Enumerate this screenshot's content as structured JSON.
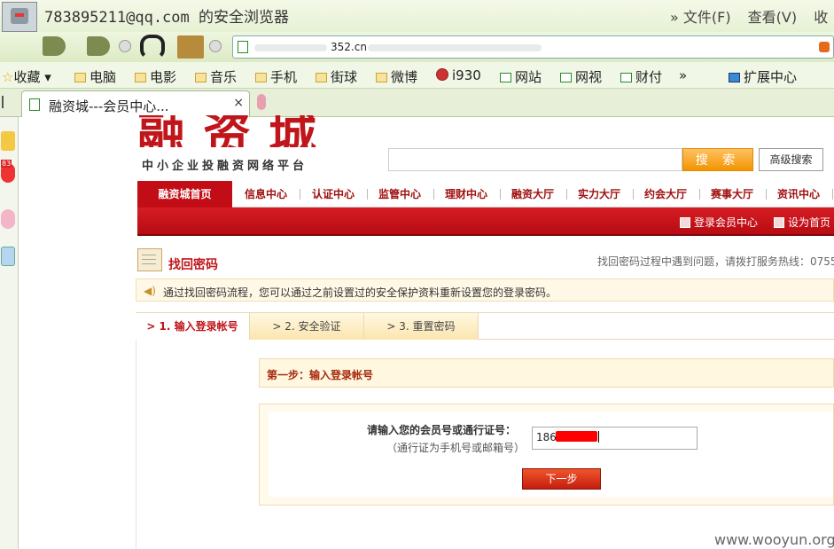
{
  "window": {
    "title": "783895211@qq.com 的安全浏览器",
    "menu": [
      "» 文件(F)",
      "查看(V)",
      "收"
    ]
  },
  "address_bar": {
    "url": "352.cn"
  },
  "favorites": [
    {
      "label": "收藏 ▾",
      "icon": "star-icon"
    },
    {
      "label": "电脑",
      "icon": "folder-icon"
    },
    {
      "label": "电影",
      "icon": "folder-icon"
    },
    {
      "label": "音乐",
      "icon": "folder-icon"
    },
    {
      "label": "手机",
      "icon": "folder-icon"
    },
    {
      "label": "街球",
      "icon": "folder-icon"
    },
    {
      "label": "微博",
      "icon": "folder-icon"
    },
    {
      "label": "i930",
      "icon": "player-icon"
    },
    {
      "label": "网站",
      "icon": "page-icon"
    },
    {
      "label": "网视",
      "icon": "page-icon"
    },
    {
      "label": "财付",
      "icon": "page-icon"
    },
    {
      "label": "»",
      "icon": ""
    },
    {
      "label": "扩展中心",
      "icon": "extension-icon"
    }
  ],
  "tab": {
    "title": "融资城---会员中心...",
    "close": "×"
  },
  "sidebar": {
    "badge": "83"
  },
  "site": {
    "logo_chars": "融资城",
    "slogan": "中小企业投融资网络平台",
    "search_button": "搜 索",
    "advanced_search": "高级搜索"
  },
  "main_nav": [
    "融资城首页",
    "信息中心",
    "认证中心",
    "监管中心",
    "理财中心",
    "融资大厅",
    "实力大厅",
    "约会大厅",
    "赛事大厅",
    "资讯中心"
  ],
  "red_bar": {
    "member_login": "登录会员中心",
    "set_home": "设为首页"
  },
  "page": {
    "title": "找回密码",
    "hotline": "找回密码过程中遇到问题，请拨打服务热线：0755",
    "notice": "通过找回密码流程，您可以通过之前设置过的安全保护资料重新设置您的登录密码。"
  },
  "steps": [
    "> 1. 输入登录帐号",
    "> 2. 安全验证",
    "> 3. 重置密码"
  ],
  "step_heading": "第一步：输入登录帐号",
  "form": {
    "label": "请输入您的会员号或通行证号：",
    "hint": "（通行证为手机号或邮箱号）",
    "value": "186        71",
    "submit": "下一步"
  },
  "watermark": "www.wooyun.org",
  "colors": {
    "brand_red": "#c30d16",
    "search_orange": "#f29300",
    "chrome_green": "#e6f1d4"
  }
}
